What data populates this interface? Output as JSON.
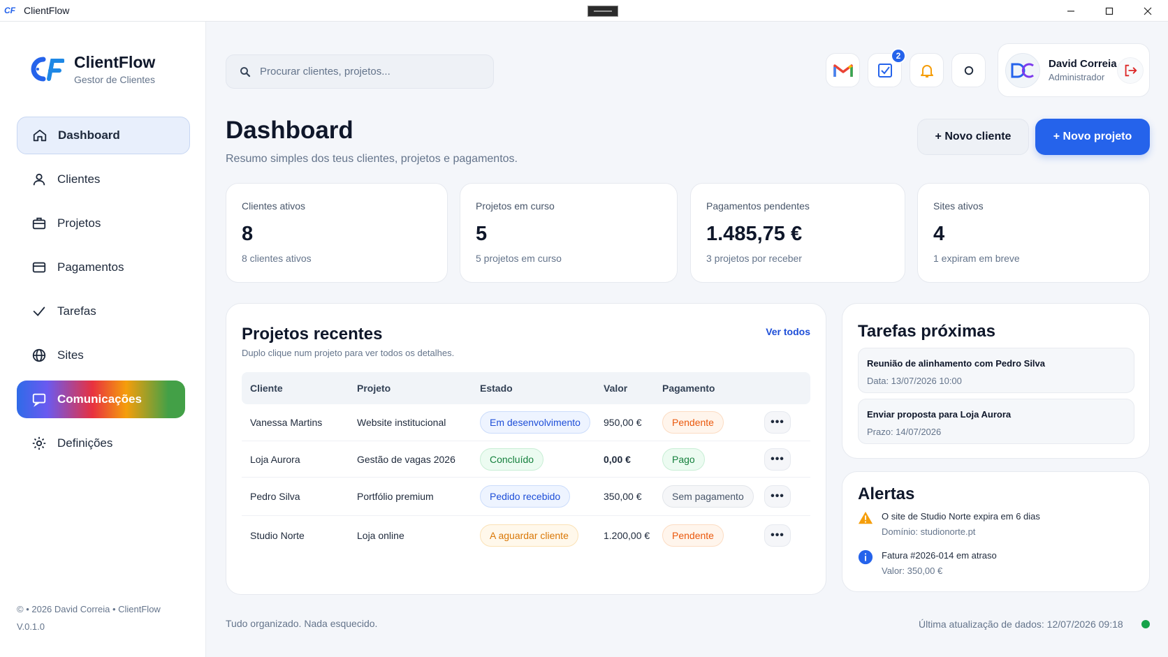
{
  "window": {
    "title": "ClientFlow",
    "logo_text": "CF"
  },
  "brand": {
    "name": "ClientFlow",
    "subtitle": "Gestor de Clientes",
    "logo_text": "CF"
  },
  "nav": [
    {
      "label": "Dashboard",
      "icon": "home-icon",
      "active": true
    },
    {
      "label": "Clientes",
      "icon": "user-icon"
    },
    {
      "label": "Projetos",
      "icon": "briefcase-icon"
    },
    {
      "label": "Pagamentos",
      "icon": "credit-card-icon"
    },
    {
      "label": "Tarefas",
      "icon": "check-icon"
    },
    {
      "label": "Sites",
      "icon": "globe-icon"
    },
    {
      "label": "Comunicações",
      "icon": "chat-icon"
    },
    {
      "label": "Definições",
      "icon": "gear-icon"
    }
  ],
  "footer": {
    "copyright": "© • 2026 David Correia • ClientFlow",
    "version": "V.0.1.0",
    "tagline": "Tudo organizado. Nada esquecido.",
    "last_update": "Última atualização de dados: 12/07/2026 09:18",
    "status_color": "#16a34a"
  },
  "search": {
    "placeholder": "Procurar clientes, projetos..."
  },
  "topbar": {
    "tasks_badge": "2"
  },
  "user": {
    "name": "David Correia",
    "role": "Administrador",
    "avatar_text": "DC"
  },
  "header": {
    "title": "Dashboard",
    "subtitle": "Resumo simples dos teus clientes, projetos e pagamentos.",
    "new_client": "+ Novo cliente",
    "new_project": "+ Novo projeto"
  },
  "stats": [
    {
      "label": "Clientes ativos",
      "value": "8",
      "note": "8 clientes ativos"
    },
    {
      "label": "Projetos em curso",
      "value": "5",
      "note": "5 projetos em curso"
    },
    {
      "label": "Pagamentos pendentes",
      "value": "1.485,75 €",
      "note": "3 projetos por receber"
    },
    {
      "label": "Sites ativos",
      "value": "4",
      "note": "1 expiram em breve"
    }
  ],
  "projects": {
    "title": "Projetos recentes",
    "see_all": "Ver todos",
    "hint": "Duplo clique num projeto para ver todos os detalhes.",
    "columns": [
      "Cliente",
      "Projeto",
      "Estado",
      "Valor",
      "Pagamento"
    ],
    "more_label": "•••",
    "rows": [
      {
        "client": "Vanessa Martins",
        "project": "Website institucional",
        "status": "Em desenvolvimento",
        "value": "950,00 €",
        "payment": "Pendente"
      },
      {
        "client": "Loja Aurora",
        "project": "Gestão de vagas 2026",
        "status": "Concluído",
        "value": "0,00 €",
        "payment": "Pago"
      },
      {
        "client": "Pedro Silva",
        "project": "Portfólio premium",
        "status": "Pedido recebido",
        "value": "350,00 €",
        "payment": "Sem pagamento"
      },
      {
        "client": "Studio Norte",
        "project": "Loja online",
        "status": "A aguardar cliente",
        "value": "1.200,00 €",
        "payment": "Pendente"
      }
    ]
  },
  "tasks": {
    "title": "Tarefas próximas",
    "items": [
      {
        "title": "Reunião de alinhamento com Pedro Silva",
        "date": "Data: 13/07/2026 10:00"
      },
      {
        "title": "Enviar proposta para Loja Aurora",
        "date": "Prazo: 14/07/2026"
      }
    ]
  },
  "alerts": {
    "title": "Alertas",
    "items": [
      {
        "icon": "warning-icon",
        "title": "O site de Studio Norte expira em 6 dias",
        "sub": "Domínio: studionorte.pt"
      },
      {
        "icon": "info-icon",
        "title": "Fatura #2026-014 em atraso",
        "sub": "Valor: 350,00 €"
      }
    ]
  }
}
